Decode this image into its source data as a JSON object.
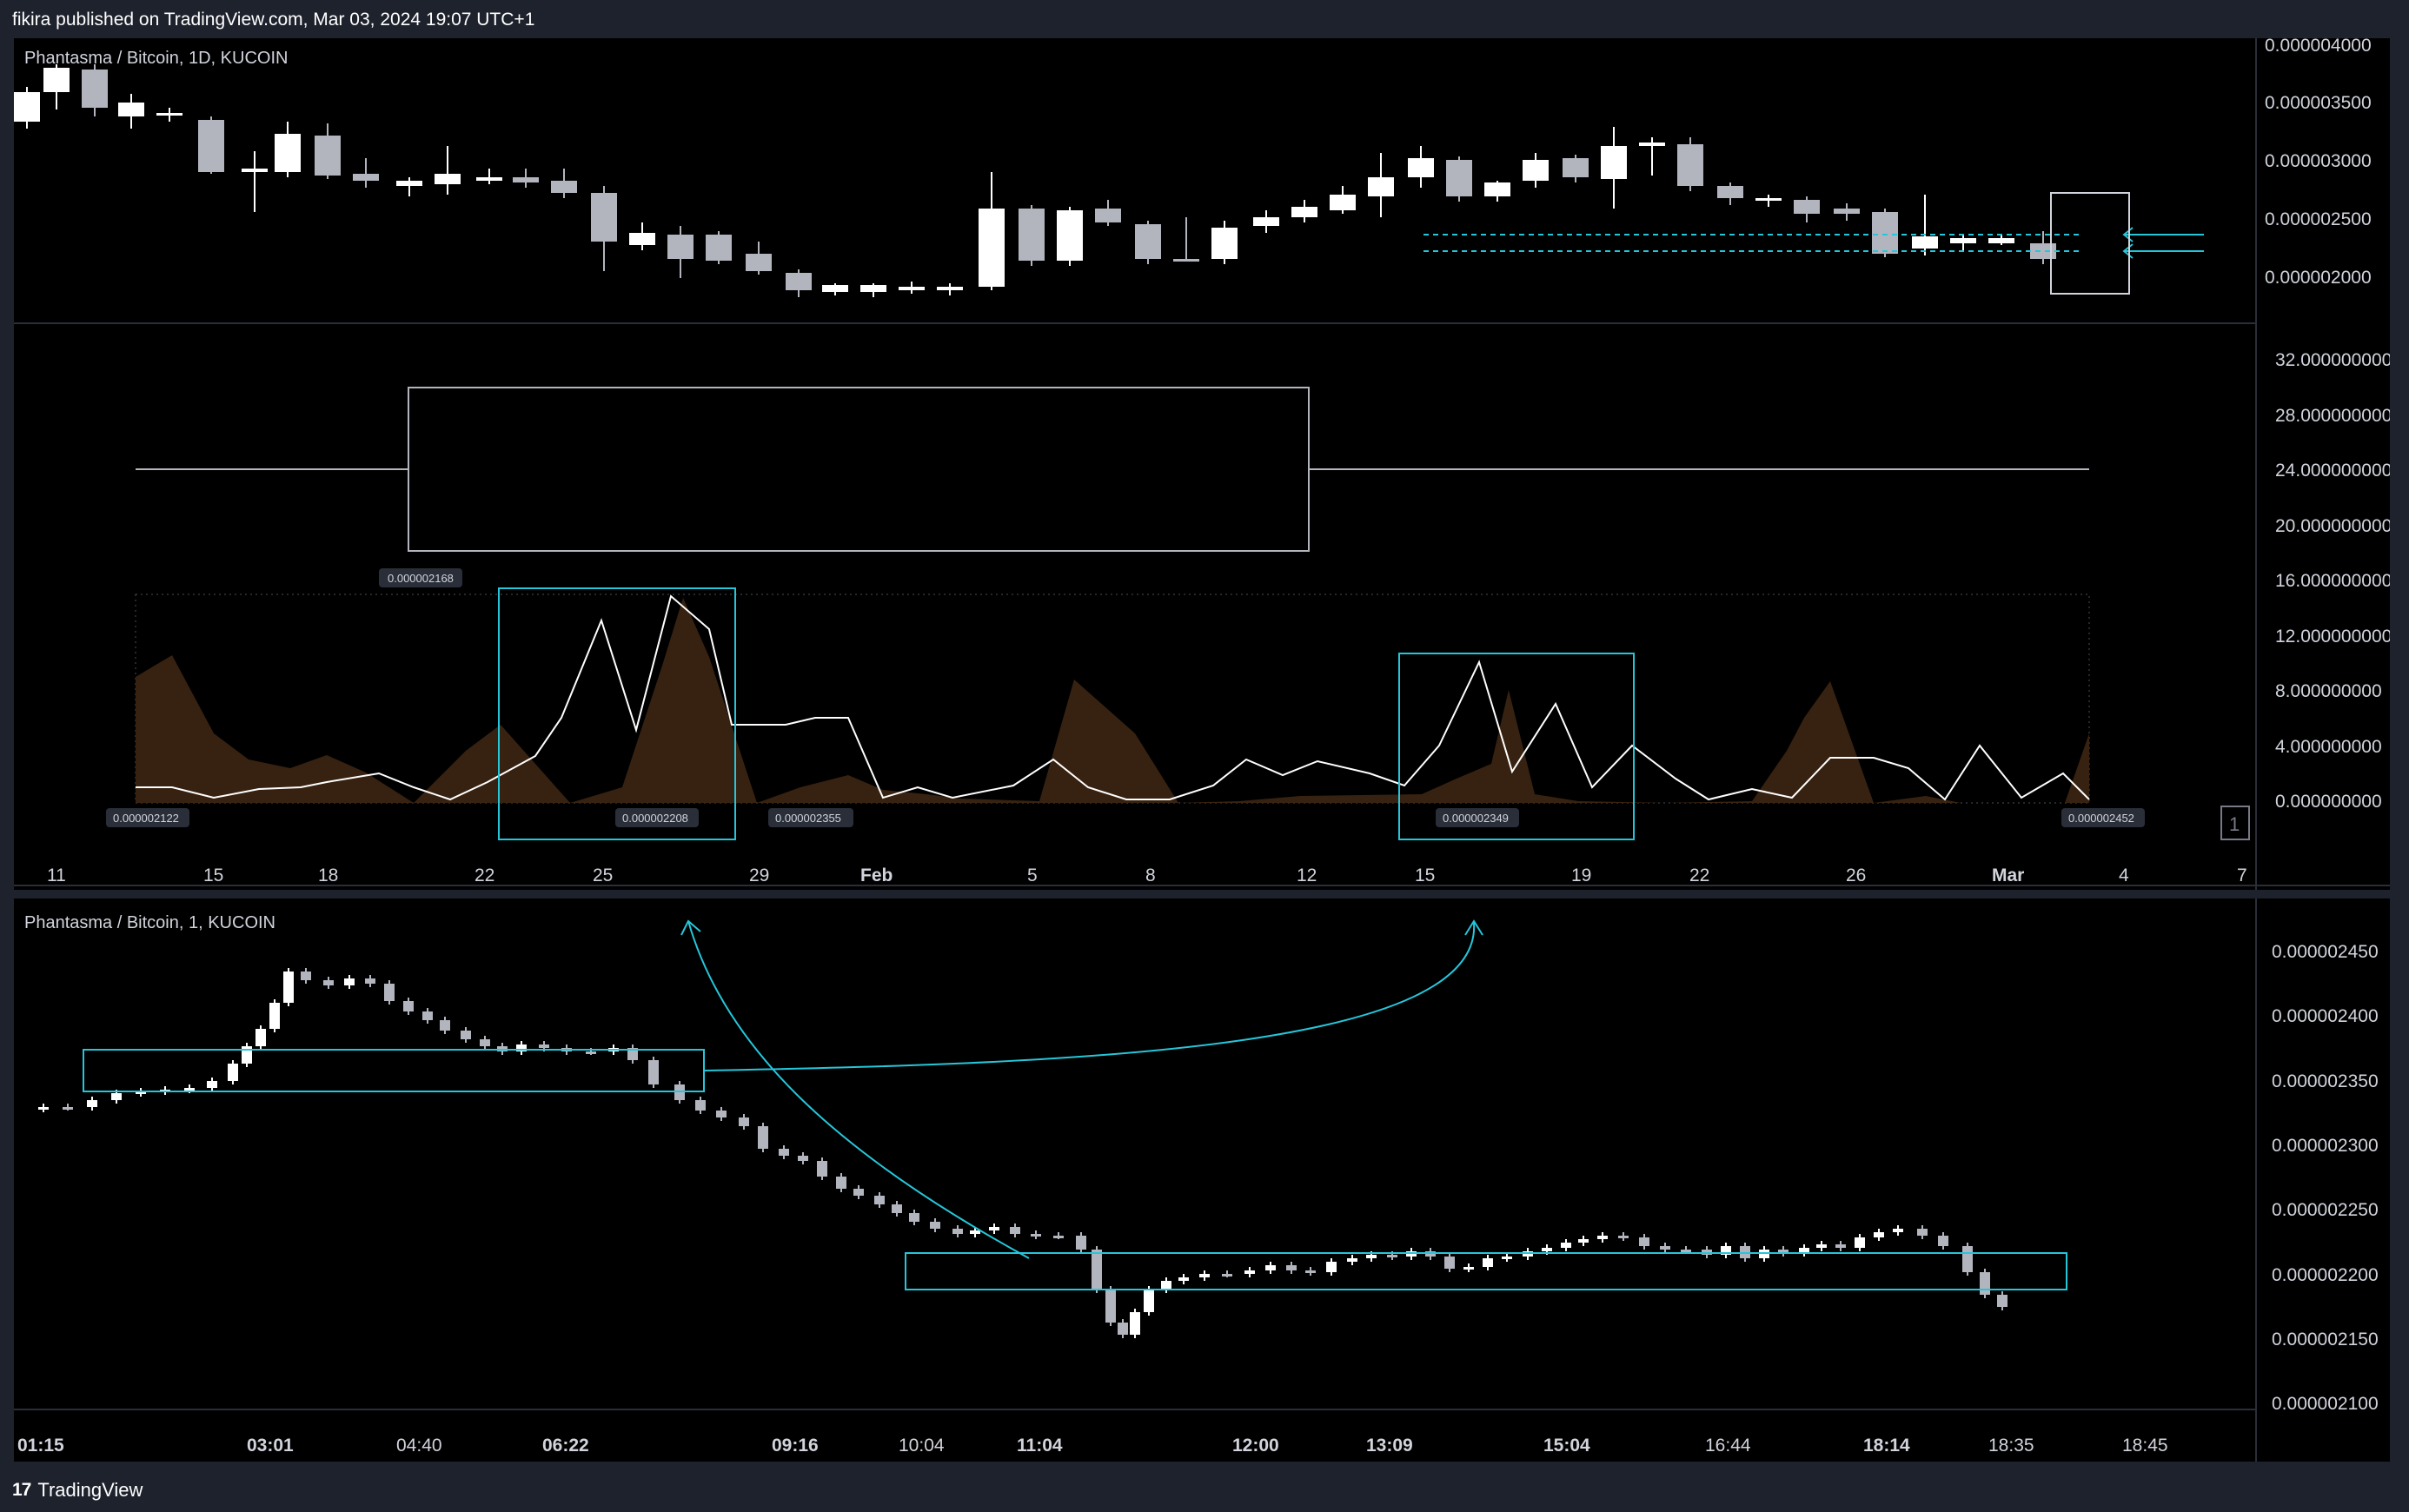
{
  "header": {
    "publish_line": "fikira published on TradingView.com, Mar 03, 2024 19:07 UTC+1"
  },
  "top_chart": {
    "symbol": "Phantasma / Bitcoin, 1D, KUCOIN",
    "price_ticks": [
      "0.000004000",
      "0.000003500",
      "0.000003000",
      "0.000002500",
      "0.000002000"
    ],
    "osc_ticks": [
      "32.000000000",
      "28.000000000",
      "24.000000000",
      "20.000000000",
      "16.000000000",
      "12.000000000",
      "8.000000000",
      "4.000000000",
      "0.000000000"
    ],
    "date_ticks": [
      "11",
      "15",
      "18",
      "22",
      "25",
      "29",
      "Feb",
      "5",
      "8",
      "12",
      "15",
      "19",
      "22",
      "26",
      "Mar",
      "4",
      "7"
    ],
    "labels": {
      "l1": "0.000002168",
      "l2": "0.000002122",
      "l3": "0.000002208",
      "l4": "0.000002355",
      "l5": "0.000002349",
      "l6": "0.000002452"
    },
    "pane_badge": "1"
  },
  "bottom_chart": {
    "symbol": "Phantasma / Bitcoin, 1, KUCOIN",
    "price_ticks": [
      "0.000002450",
      "0.000002400",
      "0.000002350",
      "0.000002300",
      "0.000002250",
      "0.000002200",
      "0.000002150",
      "0.000002100"
    ],
    "time_ticks": [
      "01:15",
      "03:01",
      "04:40",
      "06:22",
      "09:16",
      "10:04",
      "11:04",
      "12:00",
      "13:09",
      "15:04",
      "16:44",
      "18:14",
      "18:35",
      "18:45"
    ]
  },
  "footer": {
    "logo": "17",
    "brand": "TradingView"
  },
  "colors": {
    "accent": "#26c6da",
    "candle_up": "#ffffff",
    "candle_down": "#b2b5be",
    "volume_fill": "#3a2412"
  }
}
